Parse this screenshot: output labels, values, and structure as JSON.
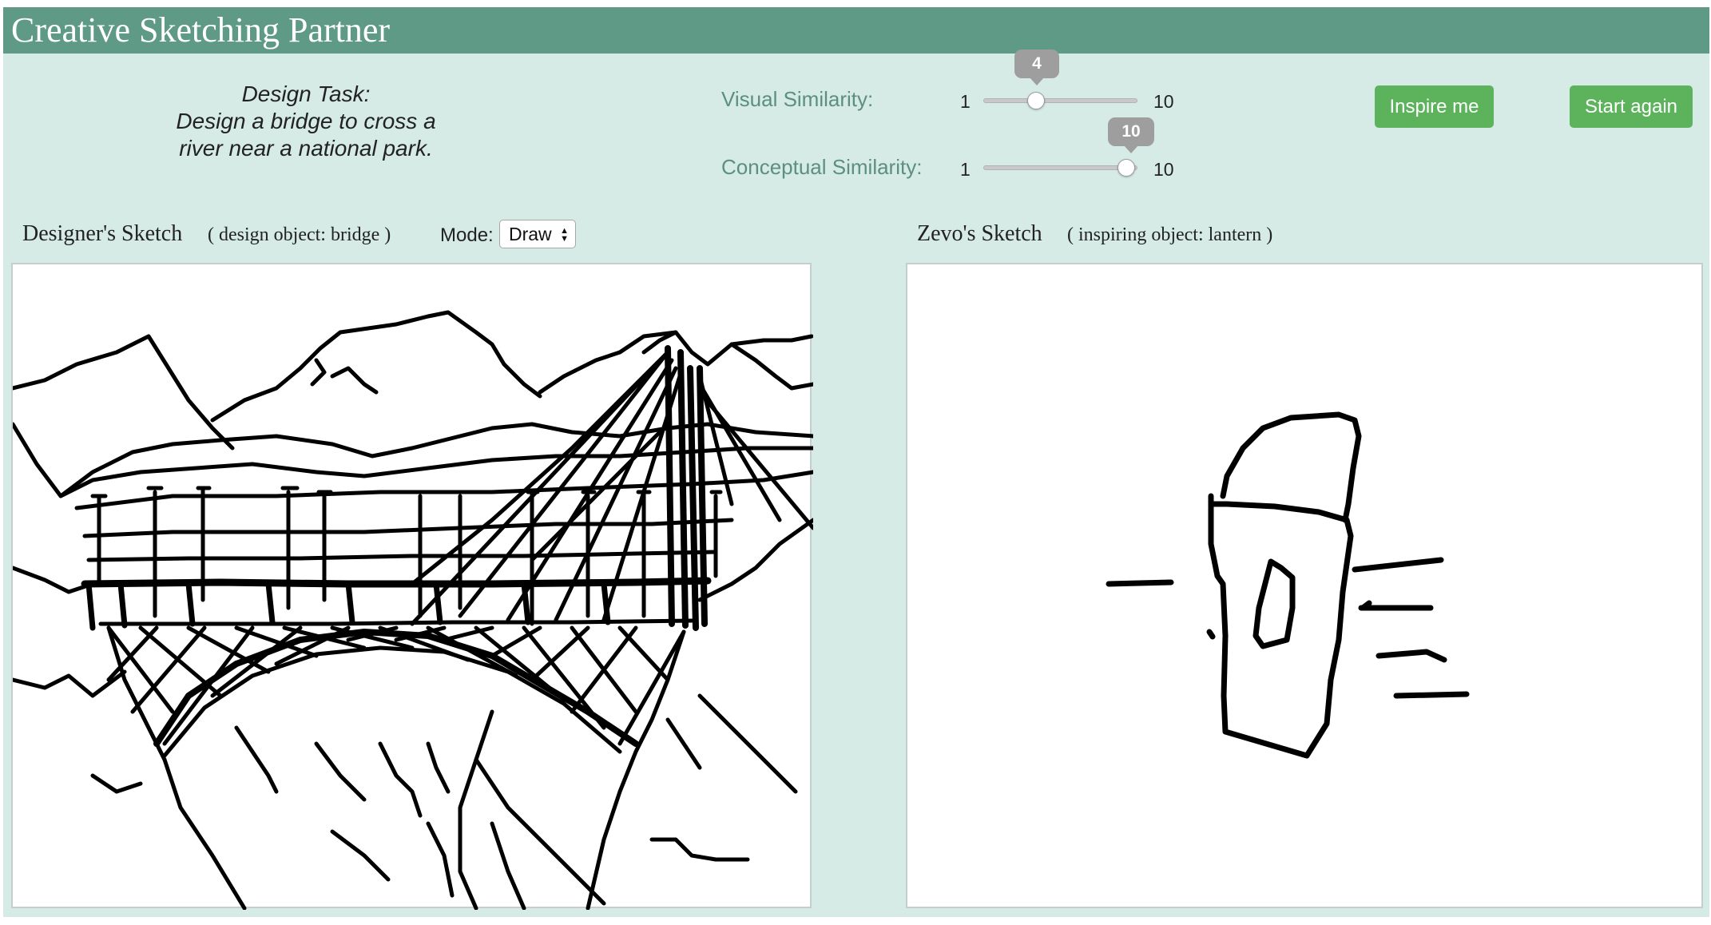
{
  "header": {
    "title": "Creative Sketching Partner"
  },
  "task": {
    "heading": "Design Task:",
    "line1": "Design a bridge to cross a",
    "line2": "river near a national park."
  },
  "sliders": {
    "visual": {
      "label": "Visual Similarity:",
      "min_label": "1",
      "max_label": "10",
      "value": "4"
    },
    "conceptual": {
      "label": "Conceptual Similarity:",
      "min_label": "1",
      "max_label": "10",
      "value": "10"
    }
  },
  "buttons": {
    "inspire": "Inspire me",
    "restart": "Start again"
  },
  "designer_panel": {
    "title": "Designer's Sketch",
    "subtitle": "( design object: bridge )",
    "mode_label": "Mode:",
    "mode_value": "Draw"
  },
  "zevo_panel": {
    "title": "Zevo's Sketch",
    "subtitle": "( inspiring object: lantern )"
  },
  "colors": {
    "header_bg": "#5e9a85",
    "app_bg": "#d6ebe6",
    "button_bg": "#5cb35c",
    "slider_bubble": "#9e9e9e",
    "label_green": "#5c8f80"
  },
  "icons": {
    "mode_select_arrows": "updown-arrows-icon"
  }
}
